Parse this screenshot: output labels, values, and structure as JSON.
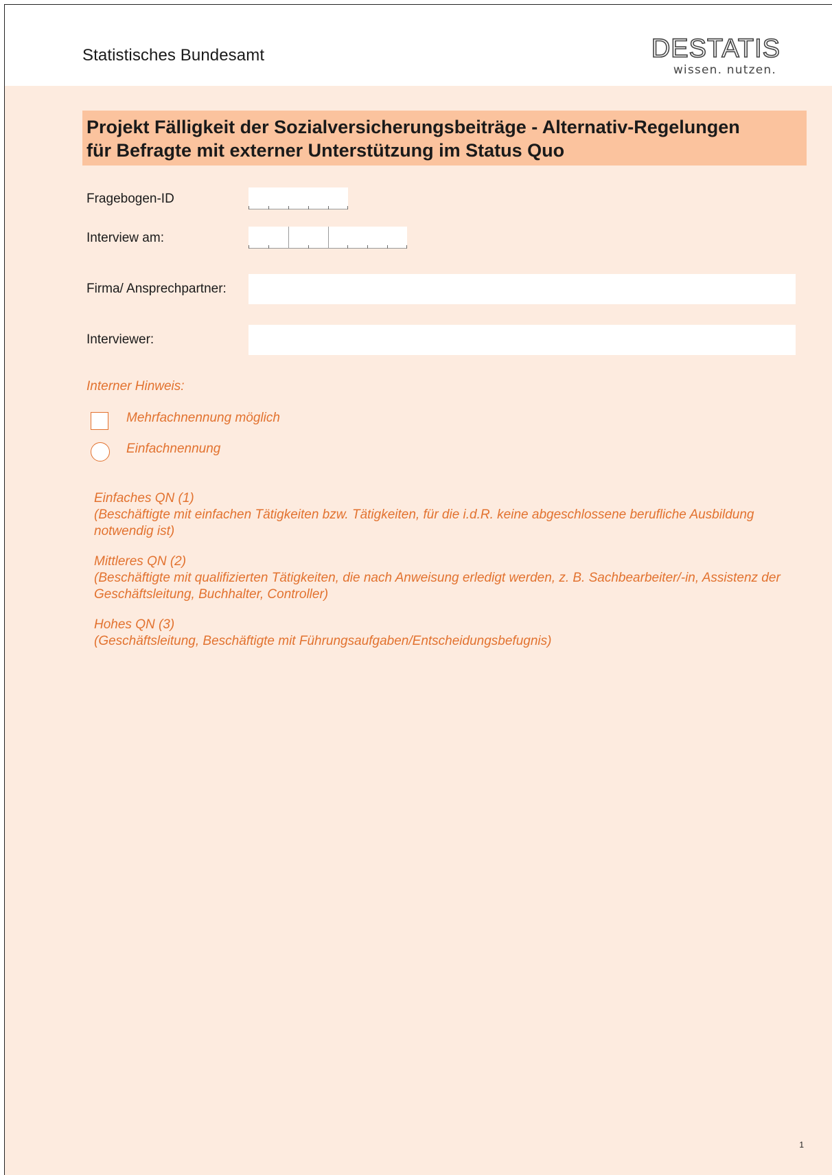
{
  "header": {
    "org_name": "Statistisches Bundesamt",
    "logo_word": "DESTATIS",
    "logo_tagline": "wissen. nutzen."
  },
  "title": {
    "line1": "Projekt Fälligkeit der Sozialversicherungsbeiträge - Alternativ-Regelungen",
    "line2": "für Befragte mit externer Unterstützung im Status Quo"
  },
  "form": {
    "questionnaire_id_label": "Fragebogen-ID",
    "questionnaire_id_value": "",
    "interview_date_label": "Interview am:",
    "interview_date_value": "",
    "company_label": "Firma/ Ansprechpartner:",
    "company_value": "",
    "interviewer_label": "Interviewer:",
    "interviewer_value": ""
  },
  "hint": {
    "title": "Interner Hinweis:",
    "multi_label": "Mehrfachnennung möglich",
    "single_label": "Einfachnennung"
  },
  "qualifications": [
    {
      "name": "Einfaches QN (1)",
      "description": "(Beschäftigte mit einfachen Tätigkeiten bzw. Tätigkeiten, für die i.d.R. keine abgeschlossene berufliche Ausbildung notwendig ist)"
    },
    {
      "name": "Mittleres QN (2)",
      "description": "(Beschäftigte mit qualifizierten Tätigkeiten, die nach Anweisung erledigt werden, z. B. Sachbearbeiter/-in, Assistenz der Geschäftsleitung, Buchhalter, Controller)"
    },
    {
      "name": "Hohes QN (3)",
      "description": "(Geschäftsleitung, Beschäftigte mit Führungsaufgaben/Entscheidungsbefugnis)"
    }
  ],
  "footer": {
    "page_number": "1"
  },
  "colors": {
    "background": "#fdebdf",
    "title_bar": "#fbc39e",
    "accent_text": "#e2722f"
  }
}
